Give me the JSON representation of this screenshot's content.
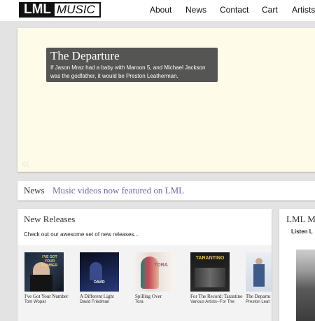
{
  "header": {
    "logo": {
      "bold": "LML",
      "italic": "MUSIC"
    },
    "nav": [
      "About",
      "News",
      "Contact",
      "Cart",
      "Artists"
    ]
  },
  "hero": {
    "title": "The Departure",
    "text": "If Jason Mraz had a baby with Maroon 5, and Michael Jackson was the godfather, it would be Preston Leatherman.",
    "prev_glyph": "«"
  },
  "news": {
    "label": "News",
    "headline": "Music videos now featured on LML"
  },
  "releases": {
    "title": "New Releases",
    "intro": "Check out our awesome set of new releases...",
    "albums": [
      {
        "title": "I've Got Your Number",
        "artist": "Tom Wopat",
        "cover_text": "I'VE GOT YOUR NUMBER"
      },
      {
        "title": "A Different Light",
        "artist": "David Friedman",
        "cover_text": "DAVID"
      },
      {
        "title": "Spilling Over",
        "artist": "Tora",
        "cover_text": "TORA"
      },
      {
        "title": "For The Record: Tarantino",
        "artist": "Various Artists--For The",
        "cover_text": "TARANTINO"
      },
      {
        "title": "The Departu",
        "artist": "Preston Leat",
        "cover_text": ""
      }
    ]
  },
  "listen": {
    "title": "LML Mu",
    "subtitle": "Listen L"
  },
  "colors": {
    "background": "#e3e3e3",
    "hero_bg": "#fefbe9",
    "link": "#6a6aaa"
  }
}
